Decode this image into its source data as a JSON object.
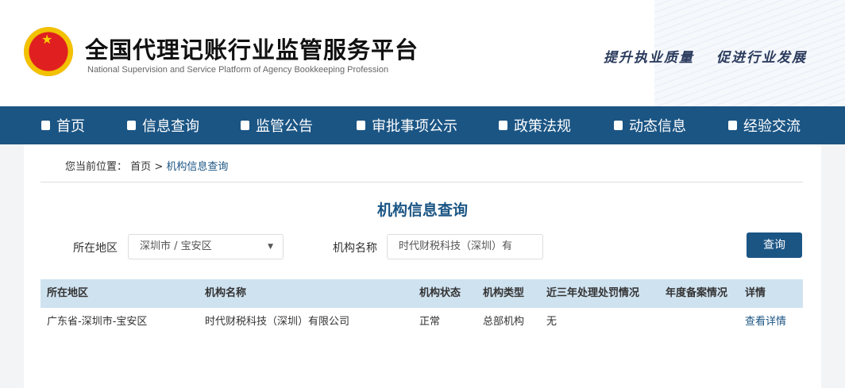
{
  "header": {
    "title": "全国代理记账行业监管服务平台",
    "subtitle": "National Supervision and Service Platform of Agency Bookkeeping  Profession",
    "slogan1": "提升执业质量",
    "slogan2": "促进行业发展"
  },
  "nav": [
    {
      "label": "首页",
      "icon": "home-icon"
    },
    {
      "label": "信息查询",
      "icon": "info-icon"
    },
    {
      "label": "监管公告",
      "icon": "monitor-icon"
    },
    {
      "label": "审批事项公示",
      "icon": "calendar-icon"
    },
    {
      "label": "政策法规",
      "icon": "bank-icon"
    },
    {
      "label": "动态信息",
      "icon": "news-icon"
    },
    {
      "label": "经验交流",
      "icon": "chat-icon"
    }
  ],
  "breadcrumb": {
    "prefix": "您当前位置：",
    "home": "首页",
    "sep": ">",
    "current": "机构信息查询"
  },
  "page_title": "机构信息查询",
  "search": {
    "region_label": "所在地区",
    "region_value": "深圳市 / 宝安区",
    "name_label": "机构名称",
    "name_value": "时代财税科技（深圳）有",
    "button": "查询"
  },
  "table": {
    "headers": [
      "所在地区",
      "机构名称",
      "机构状态",
      "机构类型",
      "近三年处理处罚情况",
      "年度备案情况",
      "详情"
    ],
    "rows": [
      [
        "广东省-深圳市-宝安区",
        "时代财税科技（深圳）有限公司",
        "正常",
        "总部机构",
        "无",
        "",
        "查看详情"
      ]
    ]
  },
  "colors": {
    "nav": "#1b5584",
    "table_header": "#cfe2f0"
  }
}
